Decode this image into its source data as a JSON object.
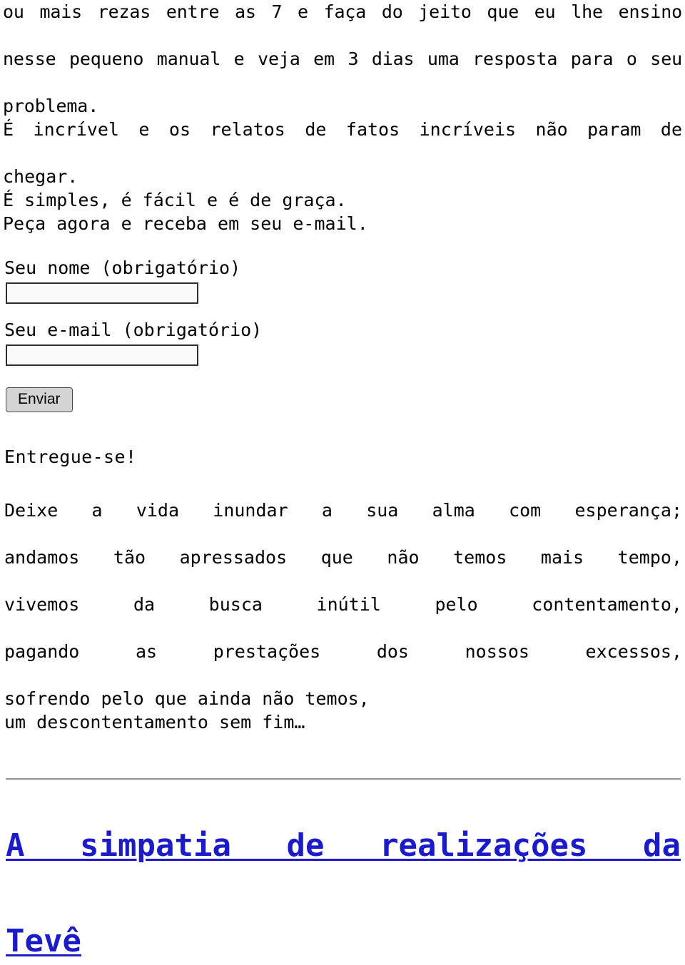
{
  "colors": {
    "text": "#000000",
    "link": "#1b1bc9",
    "input_border": "#2e2e2e",
    "input_fill": "#fafafa",
    "button_fill": "#d4d4d4",
    "divider": "#9a9a9a",
    "page_background": "#ffffff"
  },
  "intro": {
    "lines": [
      "ou mais rezas entre as 7 e faça do jeito que eu lhe ensino",
      "nesse pequeno manual e veja em 3 dias uma resposta para o seu",
      "problema."
    ]
  },
  "pitch": {
    "lines": [
      "É incrível e os relatos de fatos incríveis não param de",
      "chegar.",
      "É simples, é fácil e é de graça.",
      "Peça agora e receba em seu e-mail."
    ]
  },
  "form": {
    "name_label": "Seu nome (obrigatório)",
    "name_value": "",
    "name_placeholder": "",
    "email_label": "Seu e-mail (obrigatório)",
    "email_value": "",
    "email_placeholder": "",
    "submit_label": "Enviar"
  },
  "section": {
    "heading": "Entregue-se!"
  },
  "poem": {
    "lines": [
      "Deixe a vida inundar a sua alma com esperança;",
      "andamos tão apressados que não temos mais tempo,",
      "vivemos da busca inútil pelo contentamento,",
      "pagando as prestações dos nossos excessos,",
      "sofrendo pelo que ainda não temos,",
      "um descontentamento sem fim…"
    ]
  },
  "footer_link": {
    "line1": "A simpatia de realizações da",
    "line2": "Tevê",
    "full_text": "A simpatia de realizações da Tevê"
  }
}
